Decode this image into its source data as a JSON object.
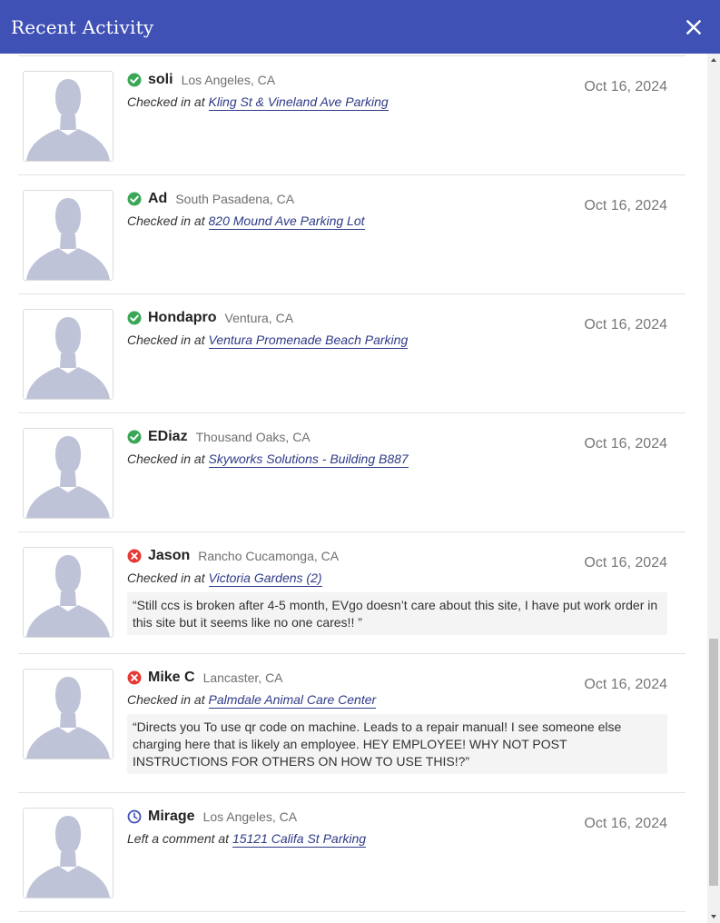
{
  "header": {
    "title": "Recent Activity",
    "close_icon": "close-icon",
    "background": "#3f51b5"
  },
  "activities": [
    {
      "username": "soli",
      "location": "Los Angeles, CA",
      "date": "Oct 16, 2024",
      "status": "success",
      "status_icon": "check-circle-icon",
      "action": "Checked in at",
      "place": "Kling St & Vineland Ave Parking",
      "comment": ""
    },
    {
      "username": "Ad",
      "location": "South Pasadena, CA",
      "date": "Oct 16, 2024",
      "status": "success",
      "status_icon": "check-circle-icon",
      "action": "Checked in at",
      "place": "820 Mound Ave Parking Lot",
      "comment": ""
    },
    {
      "username": "Hondapro",
      "location": "Ventura, CA",
      "date": "Oct 16, 2024",
      "status": "success",
      "status_icon": "check-circle-icon",
      "action": "Checked in at",
      "place": "Ventura Promenade Beach Parking",
      "comment": ""
    },
    {
      "username": "EDiaz",
      "location": "Thousand Oaks, CA",
      "date": "Oct 16, 2024",
      "status": "success",
      "status_icon": "check-circle-icon",
      "action": "Checked in at",
      "place": "Skyworks Solutions - Building B887",
      "comment": ""
    },
    {
      "username": "Jason",
      "location": "Rancho Cucamonga, CA",
      "date": "Oct 16, 2024",
      "status": "failed",
      "status_icon": "x-circle-icon",
      "action": "Checked in at",
      "place": "Victoria Gardens (2)",
      "comment": "“Still ccs is broken after 4-5 month, EVgo doesn’t care about this site, I have put work order in this site but it seems like no one cares!! ”"
    },
    {
      "username": "Mike C",
      "location": "Lancaster, CA",
      "date": "Oct 16, 2024",
      "status": "failed",
      "status_icon": "x-circle-icon",
      "action": "Checked in at",
      "place": "Palmdale Animal Care Center",
      "comment": "“Directs you To use qr code on machine. Leads to a repair manual! I see someone else charging here that is likely an employee. HEY EMPLOYEE! WHY NOT POST INSTRUCTIONS FOR OTHERS ON HOW TO USE THIS!?”"
    },
    {
      "username": "Mirage",
      "location": "Los Angeles, CA",
      "date": "Oct 16, 2024",
      "status": "comment",
      "status_icon": "clock-icon",
      "action": "Left a comment at",
      "place": "15121 Califa St Parking",
      "comment": ""
    }
  ],
  "colors": {
    "success": "#3aa757",
    "failed": "#e53935",
    "comment": "#3f51b5",
    "link": "#2e3a87",
    "avatar": "#bec3d8"
  }
}
